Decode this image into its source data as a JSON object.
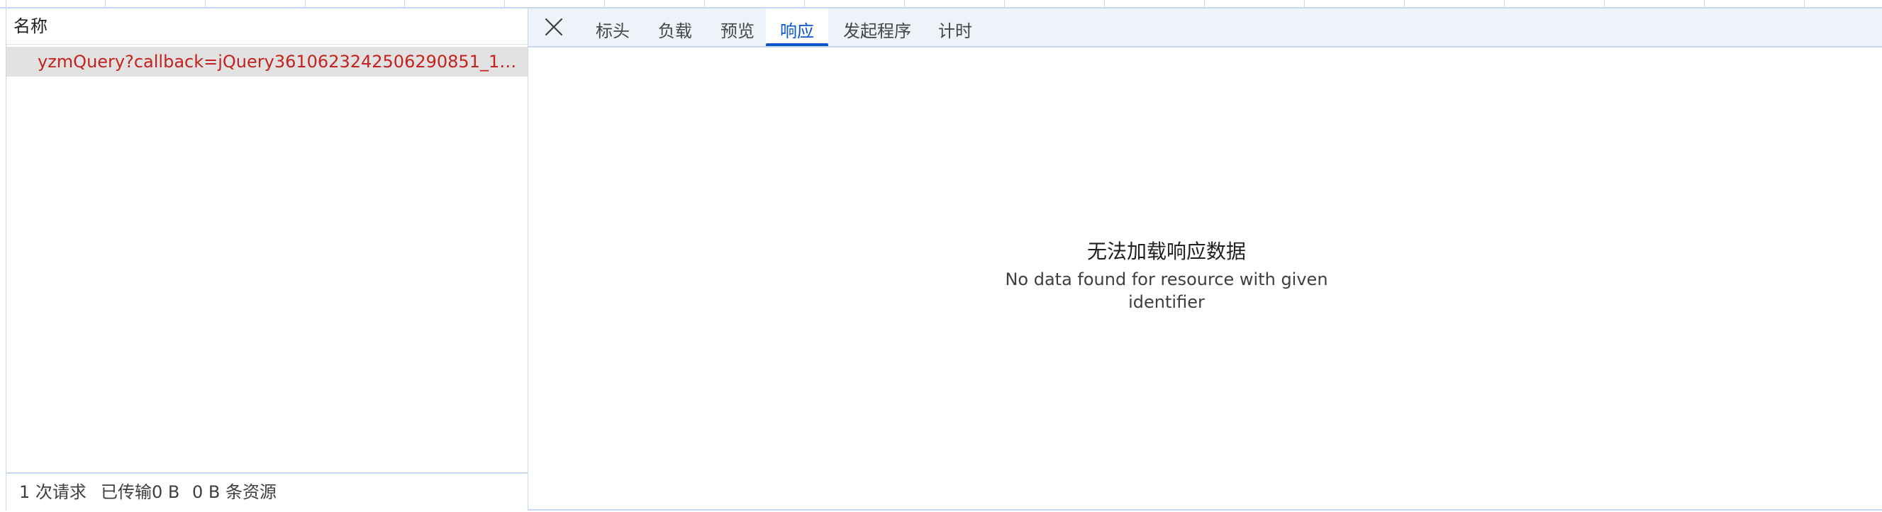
{
  "network": {
    "name_column_header": "名称",
    "requests": [
      {
        "name": "yzmQuery?callback=jQuery3610623242506290851_1751...",
        "status_color": "#c5221f"
      }
    ]
  },
  "status_bar": {
    "requests": "1 次请求",
    "transferred": "已传输0 B",
    "resources": "0 B 条资源"
  },
  "details": {
    "close_icon": "close-icon",
    "tabs": [
      {
        "label": "标头",
        "active": false
      },
      {
        "label": "负载",
        "active": false
      },
      {
        "label": "预览",
        "active": false
      },
      {
        "label": "响应",
        "active": true
      },
      {
        "label": "发起程序",
        "active": false
      },
      {
        "label": "计时",
        "active": false
      }
    ],
    "empty_title": "无法加载响应数据",
    "empty_detail": "No data found for resource with given identifier"
  },
  "colors": {
    "accent": "#0b57d0",
    "error_text": "#c5221f",
    "border": "#c8d7f0",
    "tabbar_bg": "#eef2f9",
    "selected_row_bg": "#e2e2e2"
  }
}
